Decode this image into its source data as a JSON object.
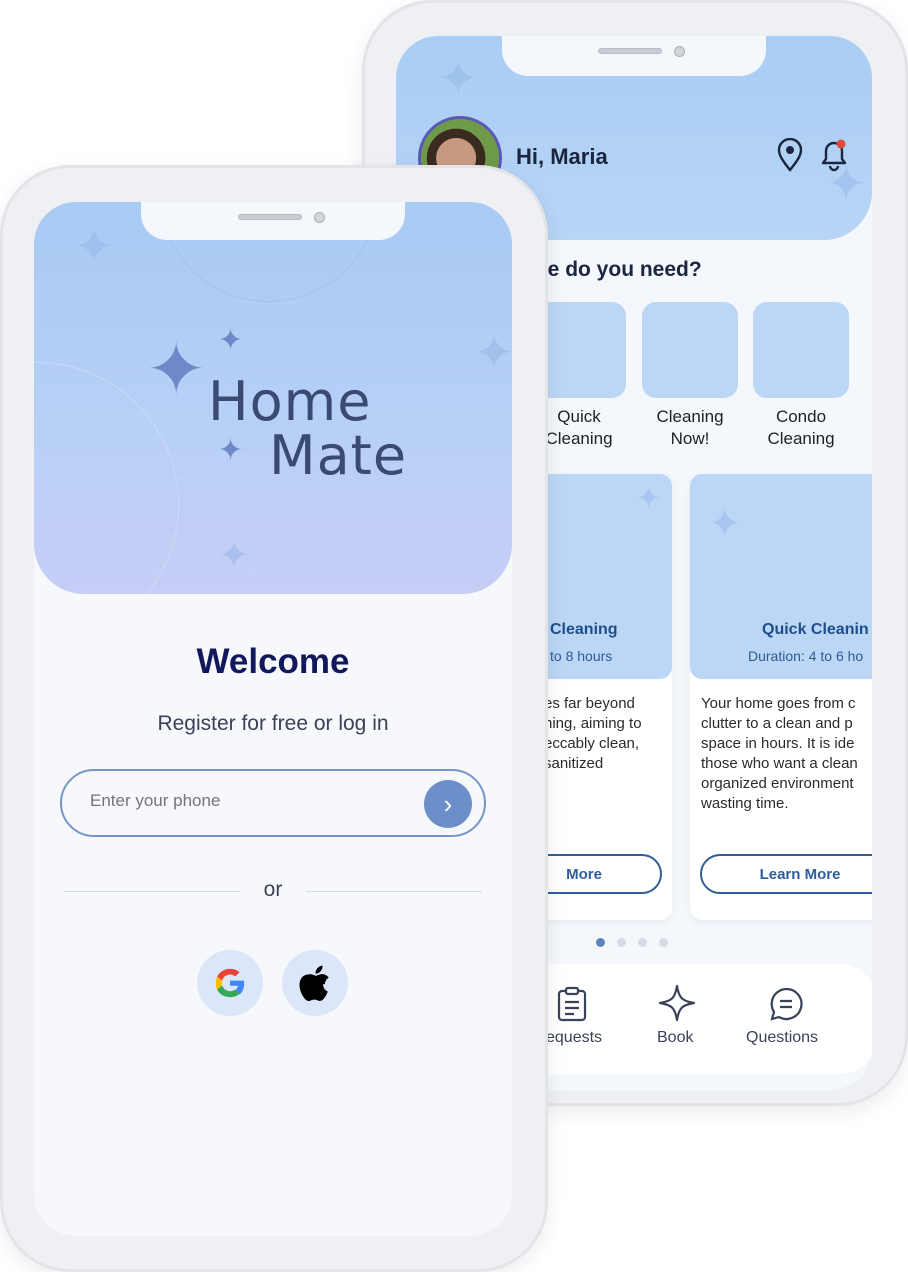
{
  "dashboard": {
    "greeting": "Hi, Maria",
    "section_title_visible": "ce do you need?",
    "services": [
      {
        "label": "Quick\nCleaning",
        "visible": "Quick\nCleaning"
      },
      {
        "label": "Cleaning\nNow!"
      },
      {
        "label": "Condo\nCleaning"
      }
    ],
    "cards": [
      {
        "title": "Cleaning",
        "duration": "to 8 hours",
        "description": "es far beyond\nning, aiming to\neccably clean,\nsanitized",
        "button": "More"
      },
      {
        "title": "Quick Cleanin",
        "duration": "Duration: 4 to 6 ho",
        "description": "Your home goes from c\nclutter to a clean and p\nspace in hours. It is ide\nthose who want a clean\norganized environment\nwasting time.",
        "button": "Learn More"
      }
    ],
    "carousel": {
      "active_index": 0,
      "count": 4
    },
    "nav": [
      {
        "label": "equests",
        "icon": "clipboard-icon"
      },
      {
        "label": "Book",
        "icon": "sparkle-icon"
      },
      {
        "label": "Questions",
        "icon": "chat-icon"
      }
    ],
    "notification_dot_color": "#e0483e"
  },
  "login": {
    "logo_line1": "Home",
    "logo_line2": "Mate",
    "welcome": "Welcome",
    "subtitle": "Register for free or log in",
    "phone_placeholder": "Enter your phone",
    "or": "or",
    "social": [
      {
        "icon": "google-icon"
      },
      {
        "icon": "apple-icon"
      }
    ],
    "accent": "#6c8fc9"
  }
}
